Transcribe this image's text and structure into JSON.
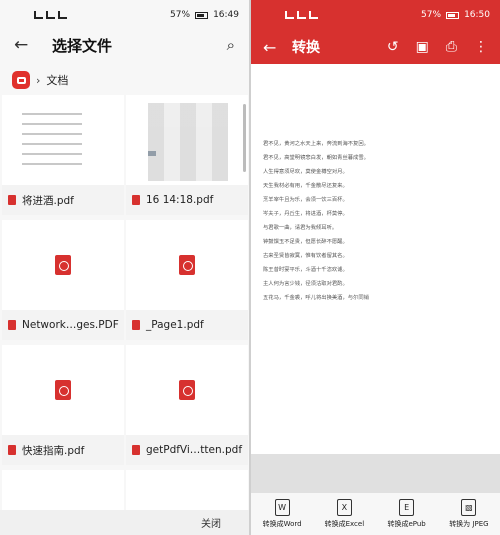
{
  "left": {
    "status": {
      "left": "...",
      "time": "16:49",
      "battery": "57%"
    },
    "header": {
      "title": "选择文件"
    },
    "breadcrumb": {
      "folder": "文档"
    },
    "files": [
      {
        "name": "将进酒.pdf"
      },
      {
        "name": "16 14:18.pdf"
      },
      {
        "name": "Network…ges.PDF"
      },
      {
        "name": "_Page1.pdf"
      },
      {
        "name": "快速指南.pdf"
      },
      {
        "name": "getPdfVi…tten.pdf"
      }
    ],
    "close": "关闭"
  },
  "right": {
    "status": {
      "time": "16:50",
      "battery": "57%"
    },
    "header": {
      "title": "转换"
    },
    "doc_lines": [
      "君不见，黄河之水天上来，奔流到海不复回。",
      "君不见，高堂明镜悲白发，朝如青丝暮成雪。",
      "人生得意须尽欢，莫使金樽空对月。",
      "天生我材必有用，千金散尽还复来。",
      "烹羊宰牛且为乐，会须一饮三百杯。",
      "岑夫子，丹丘生，将进酒，杯莫停。",
      "与君歌一曲，请君为我倾耳听。",
      "钟鼓馔玉不足贵，但愿长醉不愿醒。",
      "古来圣贤皆寂寞，惟有饮者留其名。",
      "陈王昔时宴平乐，斗酒十千恣欢谑。",
      "主人何为言少钱，径须沽取对君酌。",
      "五花马，千金裘，呼儿将出换美酒，与尔同销"
    ],
    "tools": [
      {
        "label": "转换成Word",
        "icon": "word-icon"
      },
      {
        "label": "转换成Excel",
        "icon": "excel-icon"
      },
      {
        "label": "转换成ePub",
        "icon": "epub-icon"
      },
      {
        "label": "转换为 JPEG",
        "icon": "jpeg-icon"
      }
    ]
  }
}
